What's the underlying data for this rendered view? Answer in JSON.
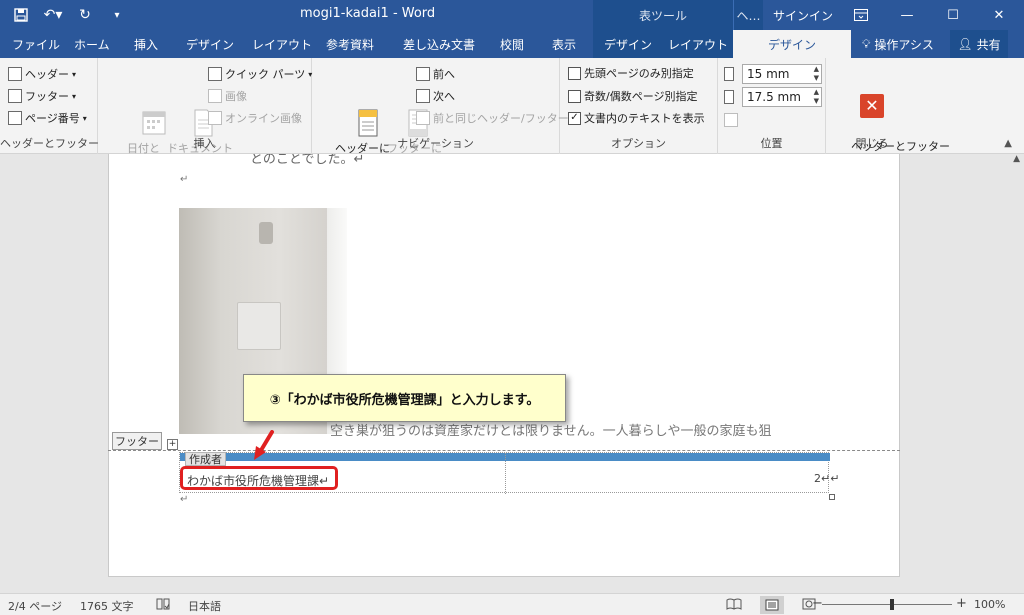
{
  "titlebar": {
    "title": "mogi1-kadai1  -  Word",
    "table_tools": "表ツール",
    "hf_tools": "ヘ…",
    "signin": "サインイン"
  },
  "tabs": [
    {
      "label": "ファイル"
    },
    {
      "label": "ホーム"
    },
    {
      "label": "挿入"
    },
    {
      "label": "デザイン"
    },
    {
      "label": "レイアウト"
    },
    {
      "label": "参考資料"
    },
    {
      "label": "差し込み文書"
    },
    {
      "label": "校閲"
    },
    {
      "label": "表示"
    },
    {
      "label": "デザイン"
    },
    {
      "label": "レイアウト"
    },
    {
      "label": "デザイン"
    }
  ],
  "tell_me": "操作アシス",
  "share": "共有",
  "ribbon": {
    "header_footer": {
      "header": "ヘッダー",
      "footer": "フッター",
      "page_number": "ページ番号",
      "label": "ヘッダーとフッター"
    },
    "insert": {
      "date_time": "日付と\n時刻",
      "doc_info": "ドキュメント\n情報",
      "quick_parts": "クイック パーツ",
      "picture": "画像",
      "online_picture": "オンライン画像",
      "label": "挿入"
    },
    "navigation": {
      "goto_header": "ヘッダーに\n移動",
      "goto_footer": "フッターに\n移動",
      "previous": "前へ",
      "next": "次へ",
      "link_previous": "前と同じヘッダー/フッター",
      "label": "ナビゲーション"
    },
    "options": {
      "first_page": "先頭ページのみ別指定",
      "odd_even": "奇数/偶数ページ別指定",
      "show_text": "文書内のテキストを表示",
      "first_page_checked": false,
      "odd_even_checked": false,
      "show_text_checked": true,
      "label": "オプション"
    },
    "position": {
      "header_pos": "15 mm",
      "footer_pos": "17.5 mm",
      "label": "位置"
    },
    "close": {
      "button": "ヘッダーとフッター\nを閉じる",
      "label": "閉じる"
    }
  },
  "document": {
    "top_line": "とのことでした。↵",
    "body_line": "空き巣が狙うのは資産家だけとは限りません。一人暮らしや一般の家庭も狙",
    "footer_tag": "フッター",
    "author_tag": "作成者",
    "cell_text": "わかば市役所危機管理課↵",
    "page_number": "2↵↵"
  },
  "callout": "③「わかば市役所危機管理課」と入力します。",
  "statusbar": {
    "page": "2/4 ページ",
    "words": "1765 文字",
    "language": "日本語",
    "zoom": "100%"
  },
  "colors": {
    "brand": "#2b579a",
    "highlight": "#e02020",
    "callout_bg": "#ffffcc"
  }
}
